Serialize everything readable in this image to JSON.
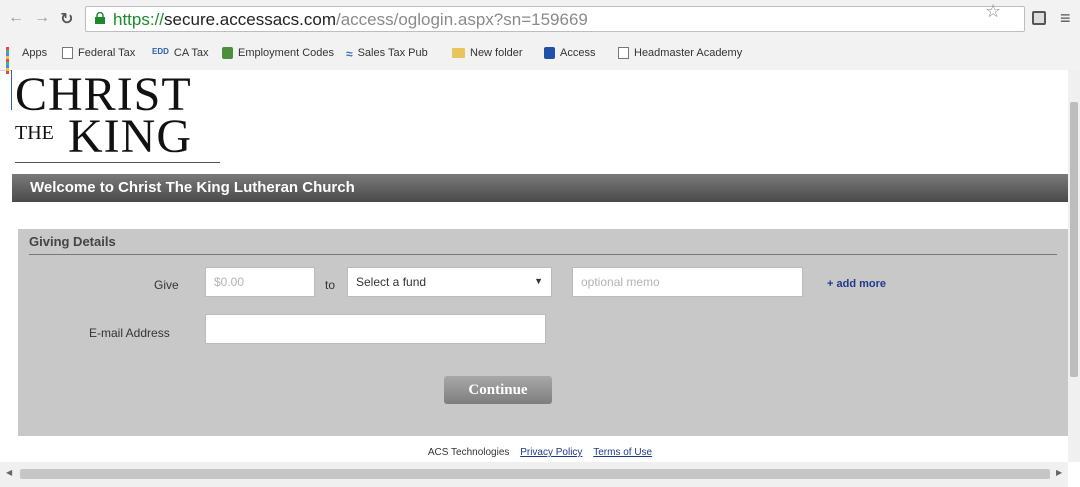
{
  "browser": {
    "url": {
      "scheme": "https://",
      "host": "secure.accessacs.com",
      "path": "/access/oglogin.aspx?sn=159669"
    },
    "bookmarks": [
      "Apps",
      "Federal Tax",
      "CA Tax",
      "Employment Codes",
      "Sales Tax Pub",
      "New folder",
      "Access",
      "Headmaster Academy"
    ],
    "bookmark_icons": [
      "apps-grid-icon",
      "page-icon",
      "edd-icon",
      "employment-icon",
      "sales-tax-icon",
      "folder-icon",
      "access-icon",
      "page-icon"
    ],
    "edd_mark": "EDD"
  },
  "logo": {
    "line1": "CHRIST",
    "line2_small": "THE",
    "line2_big": "KING"
  },
  "banner": {
    "title": "Welcome to Christ The King Lutheran Church"
  },
  "giving": {
    "section_title": "Giving Details",
    "give_label": "Give",
    "amount_placeholder": "$0.00",
    "to_label": "to",
    "fund_select_value": "Select a fund",
    "memo_placeholder": "optional memo",
    "add_more": "+ add more",
    "email_label": "E-mail Address",
    "continue_label": "Continue"
  },
  "footer": {
    "company": "ACS Technologies",
    "privacy": "Privacy Policy",
    "terms": "Terms of Use"
  },
  "colors": {
    "banner_top": "#7a7a7a",
    "banner_bottom": "#4a4a4a",
    "panel": "#c8c8c8",
    "link": "#1f3a8a",
    "secure_green": "#1e8a2e"
  }
}
